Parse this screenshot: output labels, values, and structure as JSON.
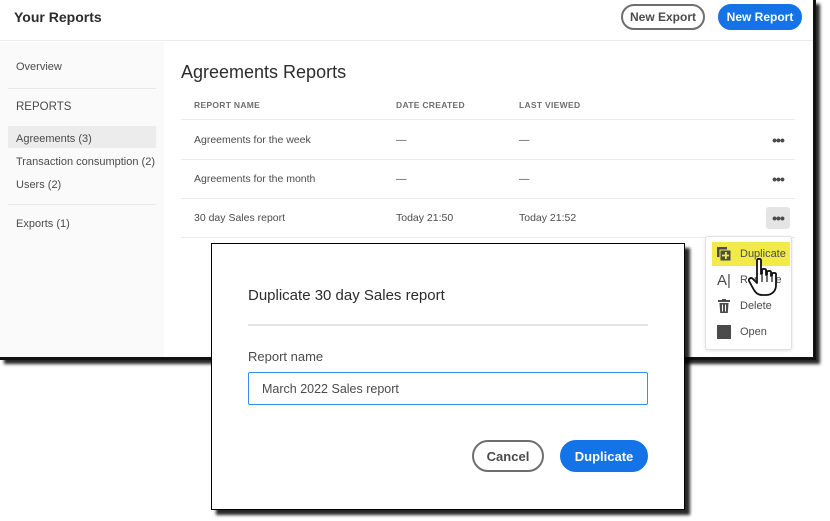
{
  "header": {
    "title": "Your Reports",
    "new_export_label": "New Export",
    "new_report_label": "New Report"
  },
  "sidebar": {
    "overview": "Overview",
    "section_label": "REPORTS",
    "items": [
      {
        "label": "Agreements (3)",
        "selected": true
      },
      {
        "label": "Transaction consumption (2)",
        "selected": false
      },
      {
        "label": "Users (2)",
        "selected": false
      }
    ],
    "exports": "Exports (1)"
  },
  "main": {
    "title": "Agreements Reports",
    "columns": [
      "REPORT NAME",
      "DATE CREATED",
      "LAST VIEWED"
    ],
    "rows": [
      {
        "name": "Agreements for the week",
        "created": "—",
        "viewed": "—",
        "more": "•••"
      },
      {
        "name": "Agreements for the month",
        "created": "—",
        "viewed": "—",
        "more": "•••"
      },
      {
        "name": "30 day Sales report",
        "created": "Today 21:50",
        "viewed": "Today 21:52",
        "more": "•••"
      }
    ]
  },
  "context_menu": {
    "items": [
      {
        "label": "Duplicate",
        "icon": "duplicate-icon",
        "highlighted": true
      },
      {
        "label": "Rename",
        "icon": "rename-icon",
        "highlighted": false
      },
      {
        "label": "Delete",
        "icon": "trash-icon",
        "highlighted": false
      },
      {
        "label": "Open",
        "icon": "open-icon",
        "highlighted": false
      }
    ]
  },
  "dialog": {
    "title": "Duplicate 30 day Sales report",
    "field_label": "Report name",
    "field_value": "March 2022 Sales report",
    "cancel_label": "Cancel",
    "confirm_label": "Duplicate"
  },
  "colors": {
    "accent": "#1473e6",
    "menu_highlight": "#f2ea4b",
    "input_border": "#378ef0"
  }
}
